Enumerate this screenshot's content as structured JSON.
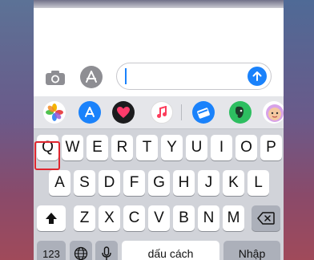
{
  "input_bar": {
    "camera_icon": "camera-icon",
    "appstore_icon": "app-store-icon",
    "message_value": "",
    "send_icon": "arrow-up-icon",
    "accent_color": "#1a82fb"
  },
  "app_strip": {
    "apps": [
      {
        "name": "photos-app-icon",
        "color": "#ffffff"
      },
      {
        "name": "app-store-app-icon",
        "color": "#1a82fb"
      },
      {
        "name": "digital-touch-app-icon",
        "color": "#1c1c1e"
      },
      {
        "name": "music-app-icon",
        "color": "#ffffff"
      },
      {
        "name": "files-app-icon",
        "color": "#1a82fb"
      },
      {
        "name": "evernote-app-icon",
        "color": "#2dbe60"
      },
      {
        "name": "memoji-app-icon",
        "color": "#ffffff"
      }
    ]
  },
  "keyboard": {
    "row1": [
      "Q",
      "W",
      "E",
      "R",
      "T",
      "Y",
      "U",
      "I",
      "O",
      "P"
    ],
    "row2": [
      "A",
      "S",
      "D",
      "F",
      "G",
      "H",
      "J",
      "K",
      "L"
    ],
    "row3": [
      "Z",
      "X",
      "C",
      "V",
      "B",
      "N",
      "M"
    ],
    "numbers_label": "123",
    "space_label": "dấu cách",
    "return_label": "Nhập",
    "shift_icon": "shift-icon",
    "delete_icon": "delete-icon",
    "globe_icon": "globe-icon",
    "mic_icon": "microphone-icon",
    "highlight_color": "#e0262f"
  }
}
